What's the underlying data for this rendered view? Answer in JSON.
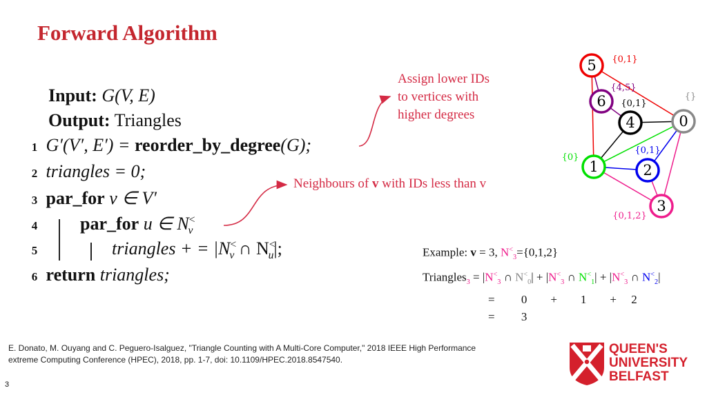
{
  "title": "Forward Algorithm",
  "algorithm": {
    "input_label": "Input:",
    "input_value": "G(V,  E)",
    "output_label": "Output:",
    "output_value": "Triangles",
    "lines": [
      {
        "num": "1",
        "pre": "G′(V′, E′) = ",
        "bold": "reorder_by_degree",
        "post": "(G);"
      },
      {
        "num": "2",
        "pre": "triangles = 0;"
      },
      {
        "num": "3",
        "bold": "par_for",
        "post": " v ∈ V′"
      },
      {
        "num": "4",
        "bold": "par_for",
        "post": " u ∈ N"
      },
      {
        "num": "5",
        "pre": "triangles + =  |N",
        "mid": "  ∩  N",
        "post": "|;"
      },
      {
        "num": "6",
        "bold": "return",
        "post": " triangles;"
      }
    ],
    "sup": "<",
    "sub_v": "v",
    "sub_u": "u"
  },
  "annotations": {
    "reorder_note": [
      "Assign lower IDs",
      "to vertices with",
      "higher degrees"
    ],
    "neighbour_note_pre": "Neighbours of ",
    "neighbour_note_bold": "v",
    "neighbour_note_post": " with IDs less than v"
  },
  "graph": {
    "nodes": [
      {
        "id": "0",
        "color": "#888888",
        "label": "{}"
      },
      {
        "id": "1",
        "color": "#00e000",
        "label": "{0}"
      },
      {
        "id": "2",
        "color": "#0000ee",
        "label": "{0,1}"
      },
      {
        "id": "3",
        "color": "#ee1c8c",
        "label": "{0,1,2}"
      },
      {
        "id": "4",
        "color": "#000000",
        "label": "{0,1}"
      },
      {
        "id": "5",
        "color": "#ee0000",
        "label": "{0,1}"
      },
      {
        "id": "6",
        "color": "#800080",
        "label": "{4,5}"
      }
    ],
    "edges": [
      {
        "from": "5",
        "to": "0",
        "color": "#ee0000"
      },
      {
        "from": "5",
        "to": "1",
        "color": "#ee0000"
      },
      {
        "from": "5",
        "to": "6",
        "color": "#800080"
      },
      {
        "from": "6",
        "to": "4",
        "color": "#800080"
      },
      {
        "from": "4",
        "to": "0",
        "color": "#000000"
      },
      {
        "from": "4",
        "to": "1",
        "color": "#000000"
      },
      {
        "from": "1",
        "to": "0",
        "color": "#00e000"
      },
      {
        "from": "1",
        "to": "2",
        "color": "#0000ee"
      },
      {
        "from": "2",
        "to": "0",
        "color": "#0000ee"
      },
      {
        "from": "1",
        "to": "3",
        "color": "#ee1c8c"
      },
      {
        "from": "2",
        "to": "3",
        "color": "#ee1c8c"
      },
      {
        "from": "0",
        "to": "3",
        "color": "#ee1c8c"
      }
    ]
  },
  "example": {
    "line1": [
      {
        "t": "Example: "
      },
      {
        "t": "v",
        "b": true
      },
      {
        "t": " = 3, "
      },
      {
        "t": "N",
        "c": "#ee1c8c"
      },
      {
        "t": "<",
        "sup": true,
        "c": "#ee1c8c"
      },
      {
        "t": "3",
        "sub": true,
        "c": "#ee1c8c"
      },
      {
        "t": "={0,1,2}"
      }
    ],
    "line2": [
      {
        "t": "Triangles"
      },
      {
        "t": "3",
        "sub": true,
        "c": "#ee1c8c"
      },
      {
        "t": " = |"
      },
      {
        "t": "N",
        "c": "#ee1c8c"
      },
      {
        "t": "<",
        "sup": true,
        "c": "#ee1c8c"
      },
      {
        "t": "3",
        "sub": true,
        "c": "#ee1c8c"
      },
      {
        "t": " ∩ "
      },
      {
        "t": "N",
        "c": "#888888"
      },
      {
        "t": "<",
        "sup": true,
        "c": "#888888"
      },
      {
        "t": "0",
        "sub": true,
        "c": "#888888"
      },
      {
        "t": "| + |"
      },
      {
        "t": "N",
        "c": "#ee1c8c"
      },
      {
        "t": "<",
        "sup": true,
        "c": "#ee1c8c"
      },
      {
        "t": "3",
        "sub": true,
        "c": "#ee1c8c"
      },
      {
        "t": " ∩ "
      },
      {
        "t": "N",
        "c": "#00e000"
      },
      {
        "t": "<",
        "sup": true,
        "c": "#00e000"
      },
      {
        "t": "1",
        "sub": true,
        "c": "#00e000"
      },
      {
        "t": "| + |"
      },
      {
        "t": "N",
        "c": "#ee1c8c"
      },
      {
        "t": "<",
        "sup": true,
        "c": "#ee1c8c"
      },
      {
        "t": "3",
        "sub": true,
        "c": "#ee1c8c"
      },
      {
        "t": " ∩ "
      },
      {
        "t": "N",
        "c": "#0000ee"
      },
      {
        "t": "<",
        "sup": true,
        "c": "#0000ee"
      },
      {
        "t": "2",
        "sub": true,
        "c": "#0000ee"
      },
      {
        "t": "|"
      }
    ],
    "line3": "=         0        +        1        +     2",
    "line4": "=         3"
  },
  "citation": [
    "E. Donato, M. Ouyang and C. Peguero-Isalguez, \"Triangle Counting with A Multi-Core Computer,\" 2018 IEEE High Performance",
    "extreme Computing Conference (HPEC), 2018, pp. 1-7, doi: 10.1109/HPEC.2018.8547540."
  ],
  "page_number": "3",
  "logo": {
    "lines": [
      "QUEEN'S",
      "UNIVERSITY",
      "BELFAST"
    ],
    "color": "#d4202c"
  }
}
